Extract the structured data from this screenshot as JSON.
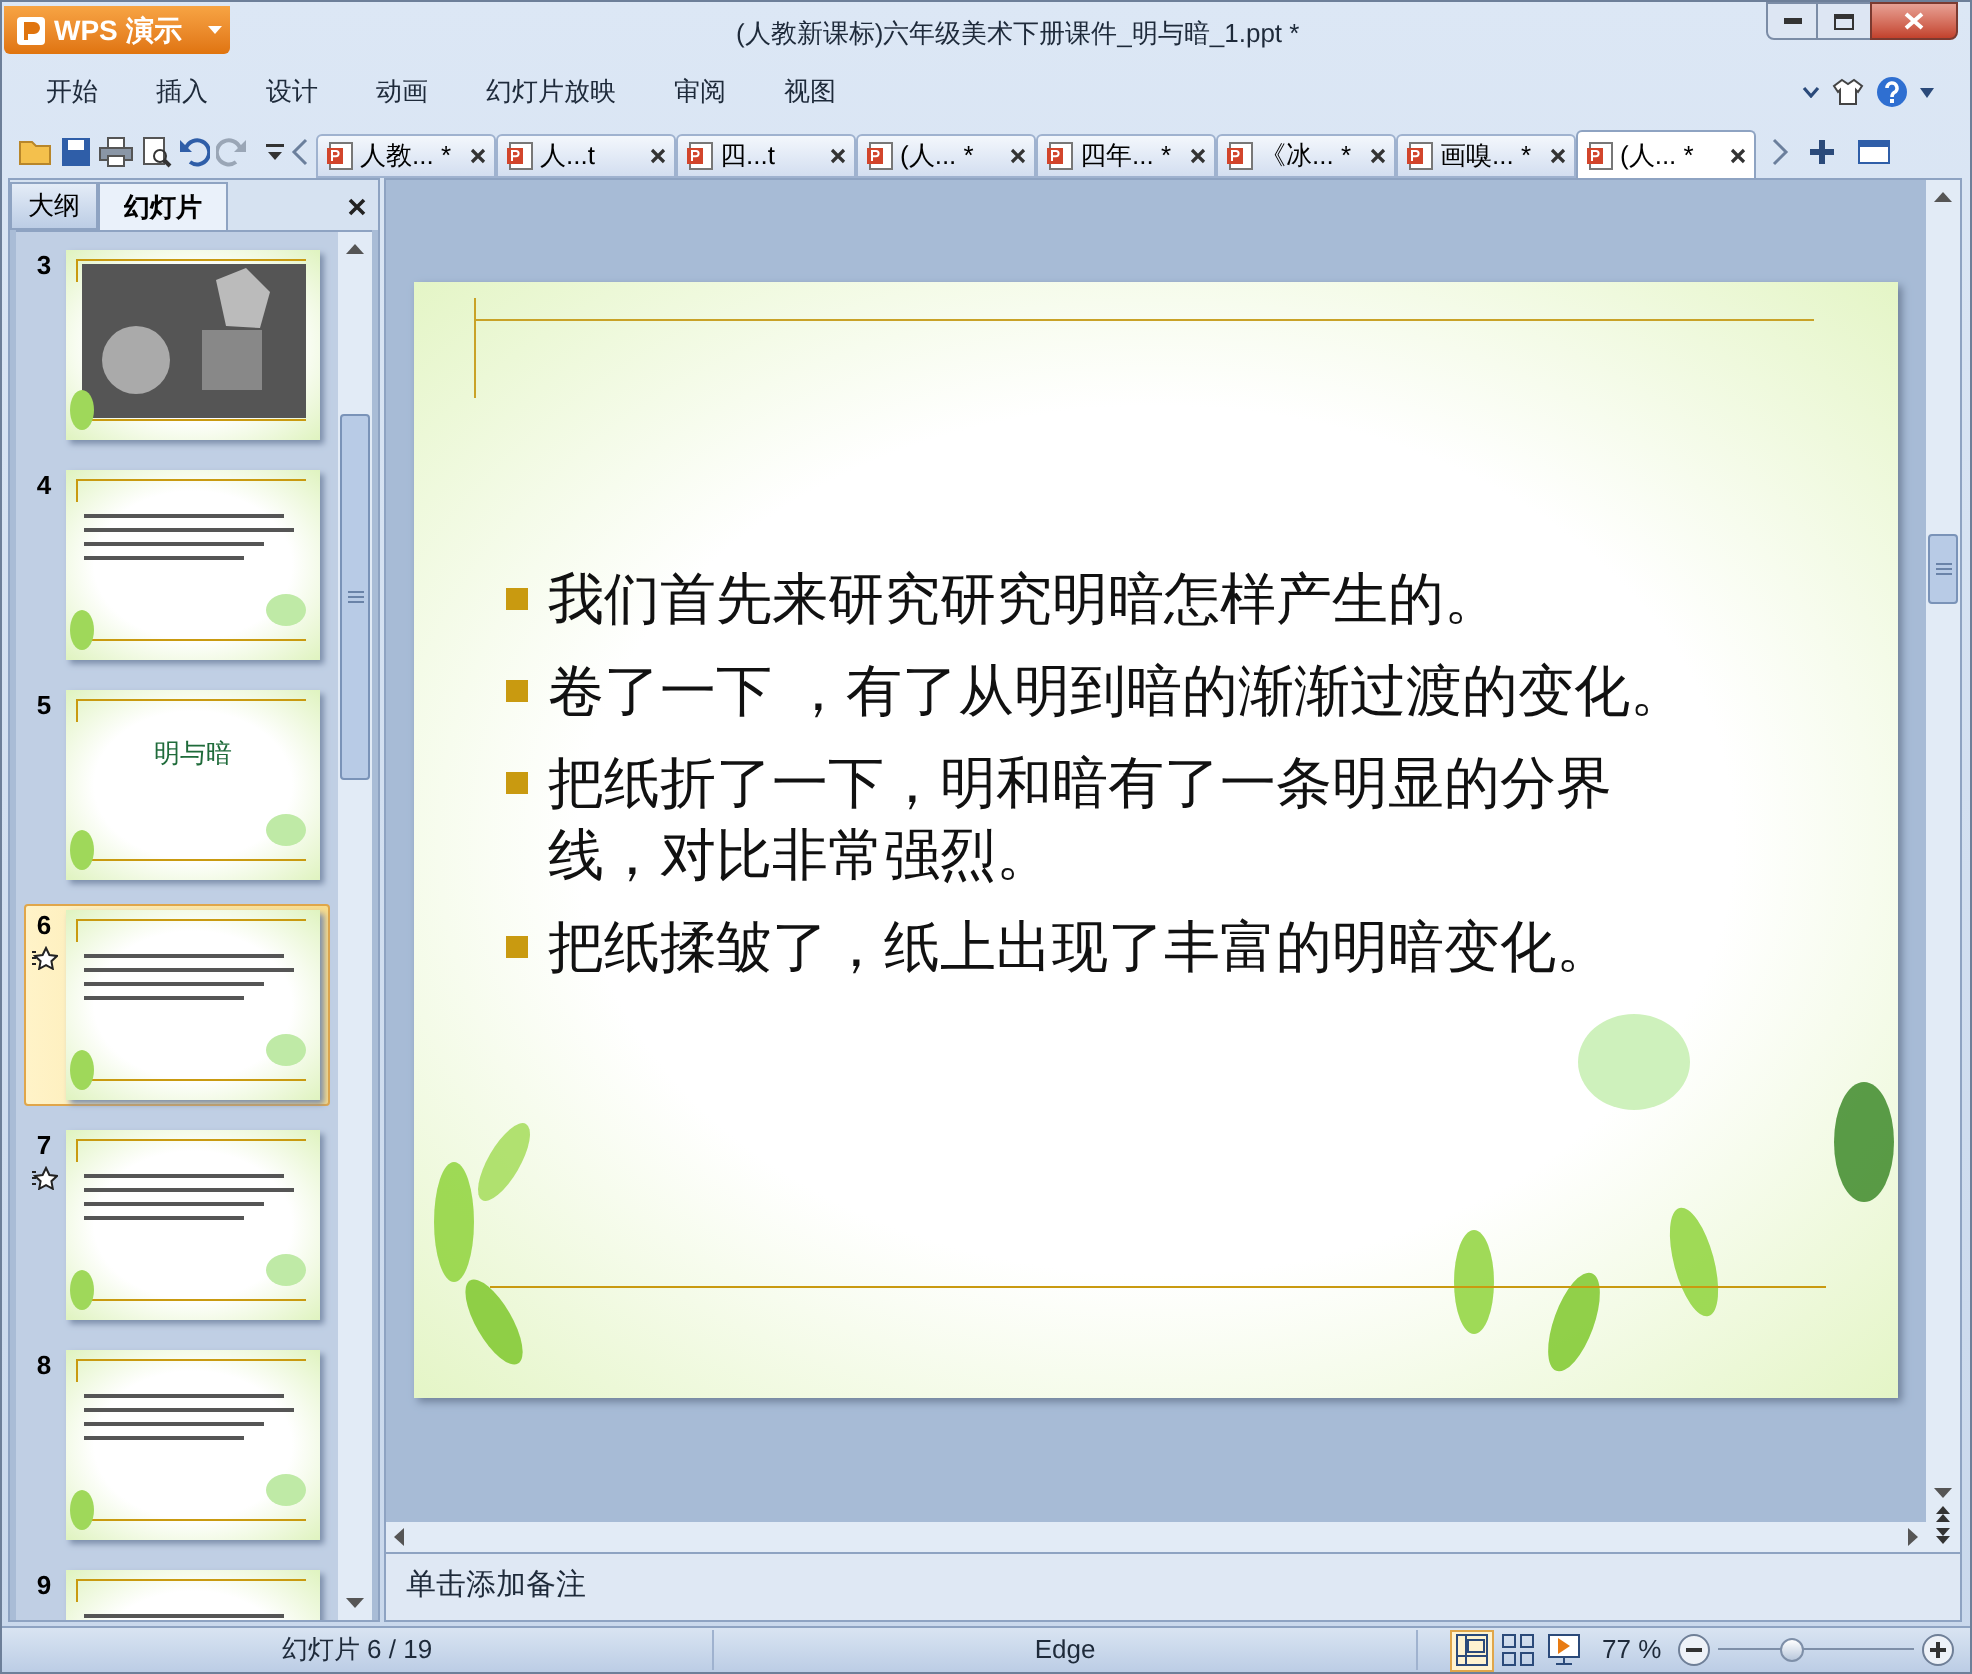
{
  "app_button": {
    "label": "WPS 演示"
  },
  "window": {
    "title": "(人教新课标)六年级美术下册课件_明与暗_1.ppt *"
  },
  "menu": [
    "开始",
    "插入",
    "设计",
    "动画",
    "幻灯片放映",
    "审阅",
    "视图"
  ],
  "doc_tabs": [
    {
      "label": "人教... *",
      "selected": false
    },
    {
      "label": "人...t",
      "selected": false
    },
    {
      "label": "四...t",
      "selected": false
    },
    {
      "label": "(人... *",
      "selected": false
    },
    {
      "label": "四年... *",
      "selected": false
    },
    {
      "label": "《冰... *",
      "selected": false
    },
    {
      "label": "画嗅... *",
      "selected": false
    },
    {
      "label": "(人... *",
      "selected": true
    }
  ],
  "panel_tabs": [
    {
      "label": "大纲",
      "selected": false
    },
    {
      "label": "幻灯片",
      "selected": true
    }
  ],
  "thumbnails": [
    {
      "number": "3",
      "kind": "photo",
      "selected": false,
      "animated": false
    },
    {
      "number": "4",
      "kind": "text",
      "selected": false,
      "animated": false
    },
    {
      "number": "5",
      "kind": "title",
      "title": "明与暗",
      "selected": false,
      "animated": false
    },
    {
      "number": "6",
      "kind": "text",
      "selected": true,
      "animated": true
    },
    {
      "number": "7",
      "kind": "text",
      "selected": false,
      "animated": true
    },
    {
      "number": "8",
      "kind": "text",
      "selected": false,
      "animated": false
    },
    {
      "number": "9",
      "kind": "text",
      "selected": false,
      "animated": false
    }
  ],
  "slide": {
    "bullets": [
      "我们首先来研究研究明暗怎样产生的。",
      "卷了一下 ，有了从明到暗的渐渐过渡的变化。",
      "把纸折了一下，明和暗有了一条明显的分界线，对比非常强烈。",
      "把纸揉皱了，纸上出现了丰富的明暗变化。"
    ]
  },
  "notes": {
    "placeholder": "单击添加备注"
  },
  "status_bar": {
    "slide_count": "幻灯片 6 / 19",
    "theme": "Edge",
    "views": [
      {
        "kind": "normal",
        "selected": true
      },
      {
        "kind": "sorter",
        "selected": false
      },
      {
        "kind": "show",
        "selected": false
      }
    ],
    "zoom": "77 %",
    "zoom_slider": {
      "level": 0.37
    }
  }
}
